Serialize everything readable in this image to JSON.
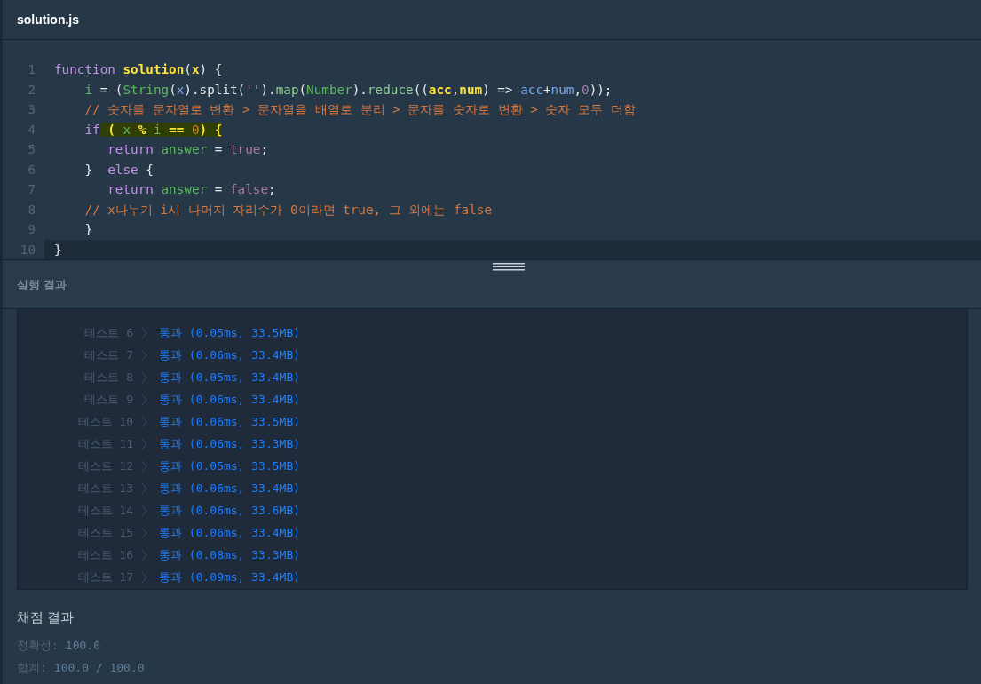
{
  "editor": {
    "file_name": "solution.js",
    "lines": [
      {
        "number": "1",
        "active": false,
        "tokens": [
          {
            "kind": "kw",
            "text": "function "
          },
          {
            "kind": "fn",
            "text": "solution"
          },
          {
            "kind": "plain",
            "text": "("
          },
          {
            "kind": "param",
            "text": "x"
          },
          {
            "kind": "plain",
            "text": ") {"
          }
        ]
      },
      {
        "number": "2",
        "active": false,
        "tokens": [
          {
            "kind": "var",
            "text": "    i"
          },
          {
            "kind": "plain",
            "text": " = ("
          },
          {
            "kind": "builtin",
            "text": "String"
          },
          {
            "kind": "plain",
            "text": "("
          },
          {
            "kind": "ref",
            "text": "x"
          },
          {
            "kind": "plain",
            "text": ").split("
          },
          {
            "kind": "string",
            "text": "''"
          },
          {
            "kind": "plain",
            "text": ")."
          },
          {
            "kind": "method",
            "text": "map"
          },
          {
            "kind": "plain",
            "text": "("
          },
          {
            "kind": "builtin",
            "text": "Number"
          },
          {
            "kind": "plain",
            "text": ")."
          },
          {
            "kind": "method",
            "text": "reduce"
          },
          {
            "kind": "plain",
            "text": "(("
          },
          {
            "kind": "param",
            "text": "acc"
          },
          {
            "kind": "plain",
            "text": ","
          },
          {
            "kind": "param",
            "text": "num"
          },
          {
            "kind": "plain",
            "text": ") => "
          },
          {
            "kind": "ref",
            "text": "acc"
          },
          {
            "kind": "plain",
            "text": "+"
          },
          {
            "kind": "ref",
            "text": "num"
          },
          {
            "kind": "plain",
            "text": ","
          },
          {
            "kind": "number",
            "text": "0"
          },
          {
            "kind": "plain",
            "text": "));"
          }
        ]
      },
      {
        "number": "3",
        "active": false,
        "tokens": [
          {
            "kind": "comment",
            "text": "    // 숫자를 문자열로 변환 > 문자열을 배열로 분리 > 문자를 숫자로 변환 > 숫자 모두 더함"
          }
        ]
      },
      {
        "number": "4",
        "active": false,
        "tokens": [
          {
            "kind": "kw",
            "text": "    if"
          },
          {
            "kind": "highlight",
            "tokens": [
              {
                "kind": "mark",
                "text": " ( "
              },
              {
                "kind": "var",
                "text": "x"
              },
              {
                "kind": "mark",
                "text": " % "
              },
              {
                "kind": "var",
                "text": "i"
              },
              {
                "kind": "mark",
                "text": " == "
              },
              {
                "kind": "number",
                "text": "0"
              },
              {
                "kind": "mark",
                "text": ") {"
              }
            ]
          }
        ]
      },
      {
        "number": "5",
        "active": false,
        "tokens": [
          {
            "kind": "kw",
            "text": "       return "
          },
          {
            "kind": "var",
            "text": "answer"
          },
          {
            "kind": "plain",
            "text": " = "
          },
          {
            "kind": "bool",
            "text": "true"
          },
          {
            "kind": "plain",
            "text": ";"
          }
        ]
      },
      {
        "number": "6",
        "active": false,
        "tokens": [
          {
            "kind": "plain",
            "text": "    }  "
          },
          {
            "kind": "kw",
            "text": "else"
          },
          {
            "kind": "plain",
            "text": " {"
          }
        ]
      },
      {
        "number": "7",
        "active": false,
        "tokens": [
          {
            "kind": "kw",
            "text": "       return "
          },
          {
            "kind": "var",
            "text": "answer"
          },
          {
            "kind": "plain",
            "text": " = "
          },
          {
            "kind": "bool",
            "text": "false"
          },
          {
            "kind": "plain",
            "text": ";"
          }
        ]
      },
      {
        "number": "8",
        "active": false,
        "tokens": [
          {
            "kind": "comment",
            "text": "    // x나누기 i시 나머지 자리수가 0이라면 true, 그 외에는 false"
          }
        ]
      },
      {
        "number": "9",
        "active": false,
        "tokens": [
          {
            "kind": "plain",
            "text": "    }"
          }
        ]
      },
      {
        "number": "10",
        "active": true,
        "tokens": [
          {
            "kind": "plain",
            "text": "}"
          }
        ]
      }
    ]
  },
  "results": {
    "title": "실행 결과",
    "tests": [
      {
        "label": "테스트 6",
        "result": "통과 (0.05ms, 33.5MB)"
      },
      {
        "label": "테스트 7",
        "result": "통과 (0.06ms, 33.4MB)"
      },
      {
        "label": "테스트 8",
        "result": "통과 (0.05ms, 33.4MB)"
      },
      {
        "label": "테스트 9",
        "result": "통과 (0.06ms, 33.4MB)"
      },
      {
        "label": "테스트 10",
        "result": "통과 (0.06ms, 33.5MB)"
      },
      {
        "label": "테스트 11",
        "result": "통과 (0.06ms, 33.3MB)"
      },
      {
        "label": "테스트 12",
        "result": "통과 (0.05ms, 33.5MB)"
      },
      {
        "label": "테스트 13",
        "result": "통과 (0.06ms, 33.4MB)"
      },
      {
        "label": "테스트 14",
        "result": "통과 (0.06ms, 33.6MB)"
      },
      {
        "label": "테스트 15",
        "result": "통과 (0.06ms, 33.4MB)"
      },
      {
        "label": "테스트 16",
        "result": "통과 (0.08ms, 33.3MB)"
      },
      {
        "label": "테스트 17",
        "result": "통과 (0.09ms, 33.4MB)"
      }
    ]
  },
  "grading": {
    "title": "채점 결과",
    "accuracy": {
      "label": "정확성:",
      "value": "100.0"
    },
    "total": {
      "label": "합계:",
      "value": "100.0 / 100.0"
    }
  }
}
